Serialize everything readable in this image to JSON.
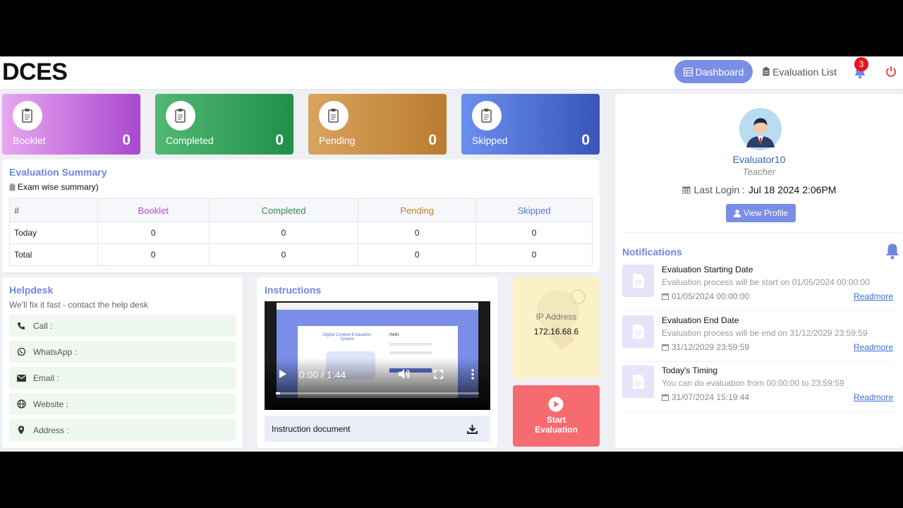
{
  "app": {
    "logo": "DCES"
  },
  "nav": {
    "dashboard": "Dashboard",
    "evaluation_list": "Evaluation List",
    "notification_count": "3"
  },
  "stats": [
    {
      "label": "Booklet",
      "value": "0",
      "gradient": [
        "#e7a7ef",
        "#a948d0"
      ]
    },
    {
      "label": "Completed",
      "value": "0",
      "gradient": [
        "#52b872",
        "#1f8f4b"
      ]
    },
    {
      "label": "Pending",
      "value": "0",
      "gradient": [
        "#d9a45f",
        "#b97b2f"
      ]
    },
    {
      "label": "Skipped",
      "value": "0",
      "gradient": [
        "#6a8ff0",
        "#3856b8"
      ]
    }
  ],
  "summary": {
    "title": "Evaluation Summary",
    "subtitle": "Exam wise summary)",
    "headers": [
      "#",
      "Booklet",
      "Completed",
      "Pending",
      "Skipped"
    ],
    "header_colors": [
      "#555555",
      "#b24fc4",
      "#2d8c4b",
      "#c17f2c",
      "#5a78d6"
    ],
    "rows": [
      [
        "Today",
        "0",
        "0",
        "0",
        "0"
      ],
      [
        "Total",
        "0",
        "0",
        "0",
        "0"
      ]
    ]
  },
  "helpdesk": {
    "title": "Helpdesk",
    "subtitle": "We'll fix it fast - contact the help desk",
    "items": [
      {
        "icon": "phone-icon",
        "label": "Call :"
      },
      {
        "icon": "whatsapp-icon",
        "label": "WhatsApp :"
      },
      {
        "icon": "email-icon",
        "label": "Email :"
      },
      {
        "icon": "globe-icon",
        "label": "Website :"
      },
      {
        "icon": "location-icon",
        "label": "Address :"
      }
    ]
  },
  "instructions": {
    "title": "Instructions",
    "video_time": "0:00 / 1:44",
    "video_heading": "Digital Content Evaluation System",
    "video_side": "Hello",
    "document_label": "Instruction document"
  },
  "ip": {
    "label": "IP Address",
    "value": "172.16.68.6"
  },
  "start": {
    "label_line1": "Start",
    "label_line2": "Evaluation"
  },
  "profile": {
    "name": "Evaluator10",
    "role": "Teacher",
    "last_login_label": "Last Login :",
    "last_login_value": "Jul 18 2024 2:06PM",
    "view_profile": "View Profile"
  },
  "notifications": {
    "title": "Notifications",
    "items": [
      {
        "title": "Evaluation Starting Date",
        "desc": "Evaluation process will be start on 01/05/2024 00:00:00",
        "date": "01/05/2024 00:00:00",
        "link": "Readmore"
      },
      {
        "title": "Evaluation End Date",
        "desc": "Evaluation process will be end on 31/12/2029 23:59:59",
        "date": "31/12/2029 23:59:59",
        "link": "Readmore"
      },
      {
        "title": "Today's Timing",
        "desc": "You can do evaluation from 00:00:00 to 23:59:59",
        "date": "31/07/2024 15:19:44",
        "link": "Readmore"
      }
    ]
  }
}
